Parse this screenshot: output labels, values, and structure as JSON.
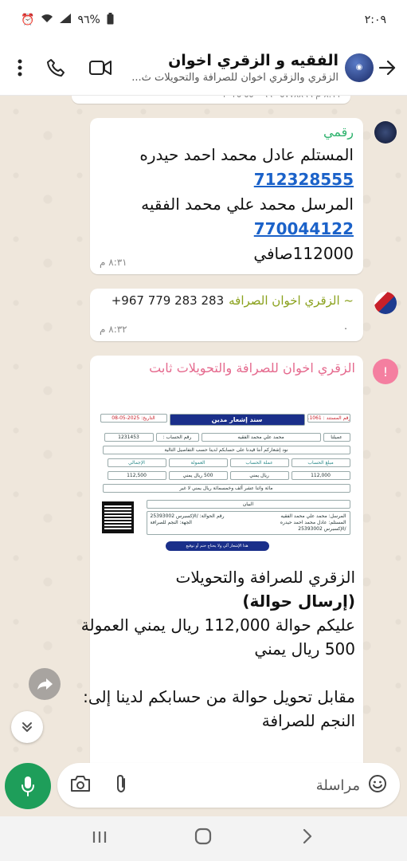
{
  "status": {
    "time": "٢:٠٩",
    "battery": "٩٦%"
  },
  "header": {
    "title": "الفقيه و الزقري اخوان",
    "subtitle": "الزقري والزقري اخوان للصرافة والتحويلات ث..."
  },
  "prev_stub": "٨:١١ م  ٠٥٧٧٨٨٩٩ ٥٥٠٠٦٦ ٢٠٢٥",
  "messages": [
    {
      "sender": "رقمي",
      "lines": [
        "المستلم عادل محمد احمد حيدره",
        "712328555",
        "المرسل محمد علي محمد الفقيه",
        "770044122",
        "112000صافي"
      ],
      "time": "٨:٣١ م"
    },
    {
      "sender": "~ الزقري اخوان الصرافه",
      "phone": "+967 779 283 283",
      "body": ".",
      "time": "٨:٣٢ م"
    },
    {
      "sender": "الزقري اخوان للصرافة والتحويلات ثابت",
      "doc": {
        "title": "سند إشعار مدين",
        "doc_no_label": "رقم المستند : 11061",
        "date_label": "التاريخ: 2025-05-08",
        "client_label": "عميلنا",
        "client_name": "محمد علي محمد الفقيه",
        "account_label": "رقم الحساب :",
        "account_no": "1231453",
        "notice": "نود إشعاركم أننا قيدنا على حسابكم لدينا حسب التفاصيل التالية",
        "col_amount": "مبلغ الحساب",
        "col_currency": "عملة الحساب",
        "col_fee": "العمولة",
        "col_total": "الإجمالي",
        "val_amount": "112,000",
        "val_currency": "ريال يمني",
        "val_fee": "500 ريال يمني",
        "val_total": "112,500",
        "words": "مائة واثنا عشر ألف وخمسمائة ريال يمني لا غير",
        "desc_label": "البيان",
        "sender_line": "المرسل: محمد علي محمد الفقيه",
        "receiver_line": "المستلم: عادل محمد احمد حيدره",
        "ref_line": "رقم الحوالة: /الإكسبرس 25393002",
        "dest_line": "الجهة: النجم للصرافة",
        "ref_line2": "/الإكسبرس 25393002",
        "footer": "هذا الإشعار آلي ولا يحتاج ختم أو توقيع"
      },
      "text": [
        "الزقري للصرافة والتحويلات",
        "(إرسال حوالة)",
        "عليكم حوالة 112,000 ريال يمني العمولة",
        "500 ريال يمني",
        "",
        "مقابل تحويل حوالة من حسابكم لدينا إلى:",
        "النجم للصرافة"
      ]
    }
  ],
  "composer": {
    "placeholder": "مراسلة"
  }
}
